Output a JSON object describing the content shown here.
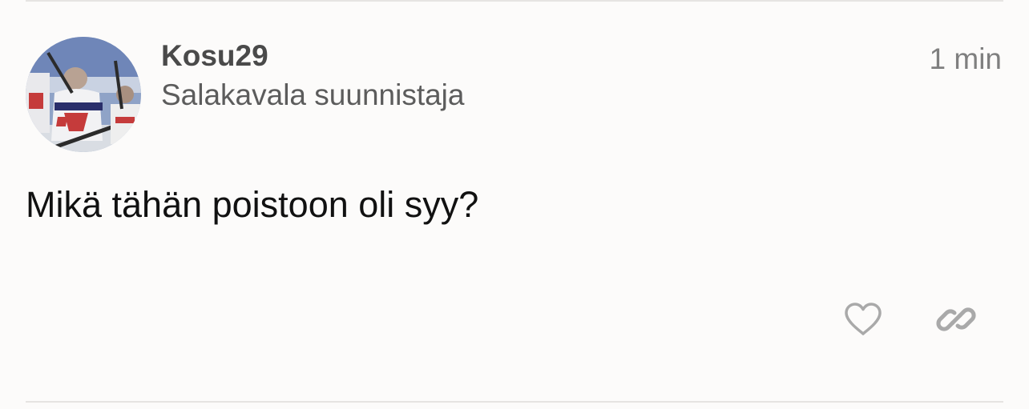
{
  "post": {
    "author": {
      "username": "Kosu29",
      "title": "Salakavala suunnistaja",
      "avatar_icon": "avatar-photo"
    },
    "timestamp": "1 min",
    "content": "Mikä tähän poistoon oli syy?",
    "actions": {
      "like_icon": "heart-icon",
      "link_icon": "link-icon",
      "icon_color": "#a9a9a9"
    }
  }
}
